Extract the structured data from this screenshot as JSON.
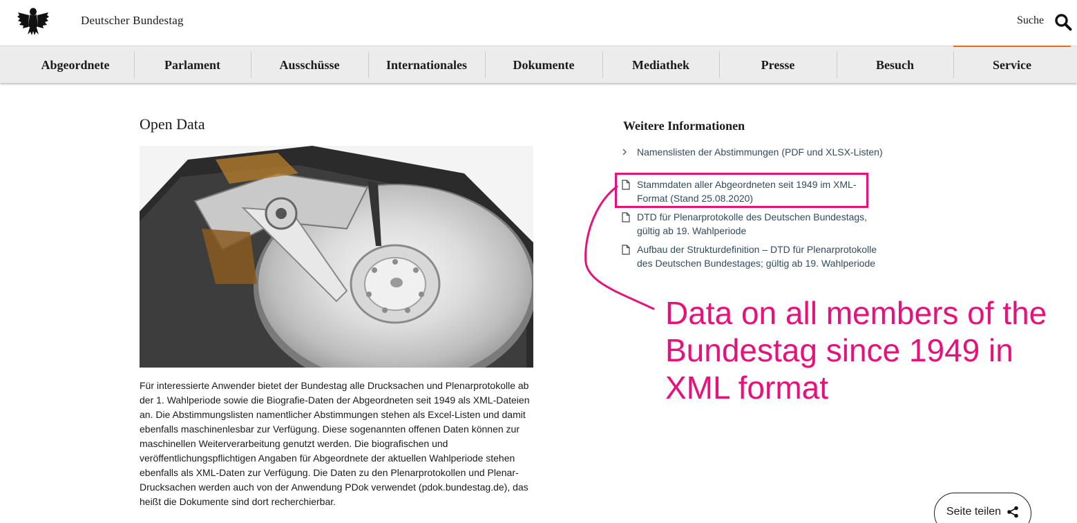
{
  "header": {
    "site_title": "Deutscher Bundestag",
    "search_label": "Suche"
  },
  "nav": {
    "items": [
      "Abgeordnete",
      "Parlament",
      "Ausschüsse",
      "Internationales",
      "Dokumente",
      "Mediathek",
      "Presse",
      "Besuch",
      "Service"
    ],
    "active": "Service",
    "active_color": "#e86a1c"
  },
  "main": {
    "title": "Open Data",
    "image_info_icon": "i",
    "body": "Für interessierte Anwender bietet der Bundestag alle Drucksachen und Plenarprotokolle ab der 1. Wahlperiode sowie die Biografie-Daten der Abgeordneten seit 1949 als XML-Dateien an. Die Abstimmungslisten namentlicher Abstimmungen stehen als Excel-Listen und damit ebenfalls maschinenlesbar zur Verfügung. Diese sogenannten offenen Daten können zur maschinellen Weiterverarbeitung genutzt werden. Die biografischen und veröffentlichungspflichtigen Angaben für Abgeordnete der aktuellen Wahlperiode stehen ebenfalls als XML-Daten zur Verfügung. Die Daten zu den Plenarprotokollen und Plenar-Drucksachen werden auch von der Anwendung PDok verwendet (pdok.bundestag.de), das heißt die Dokumente sind dort recherchierbar."
  },
  "sidebar": {
    "title": "Weitere Informationen",
    "links": [
      {
        "icon": "chevron-right-icon",
        "text": "Namenslisten der Abstimmungen (PDF und XLSX-Listen)"
      },
      {
        "icon": "document-icon",
        "text": "Stammdaten aller Abgeordneten seit 1949 im XML-Format (Stand 25.08.2020)"
      },
      {
        "icon": "document-icon",
        "text": "DTD für Plenarprotokolle des Deutschen Bundestags, gültig ab 19. Wahlperiode"
      },
      {
        "icon": "document-icon",
        "text": "Aufbau der Strukturdefinition – DTD für Plenarprotokolle des Deutschen Bundestages; gültig ab 19. Wahlperiode"
      }
    ]
  },
  "annotation": {
    "text": "Data on all members of the Bundestag since 1949 in XML format",
    "color": "#e8107a"
  },
  "share": {
    "label": "Seite teilen"
  }
}
